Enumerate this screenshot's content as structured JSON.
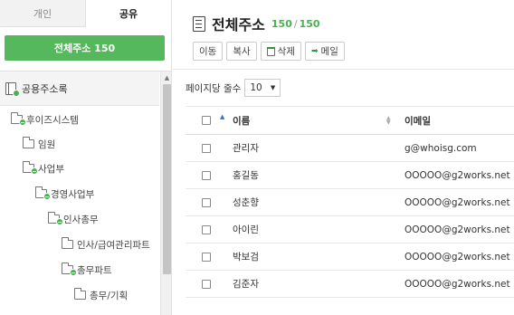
{
  "sidebar": {
    "tabs": [
      {
        "label": "개인",
        "active": false
      },
      {
        "label": "공유",
        "active": true
      }
    ],
    "all_button": "전체주소 150",
    "tree_root": "공용주소록",
    "tree": [
      {
        "label": "후이즈시스템",
        "badge": true
      },
      {
        "label": "임원",
        "badge": false
      },
      {
        "label": "사업부",
        "badge": true
      },
      {
        "label": "경영사업부",
        "badge": true
      },
      {
        "label": "인사총무",
        "badge": true
      },
      {
        "label": "인사/급여관리파트",
        "badge": false
      },
      {
        "label": "총무파트",
        "badge": true
      },
      {
        "label": "총무/기획",
        "badge": false
      }
    ]
  },
  "main": {
    "title": "전체주소",
    "count_current": "150",
    "count_separator": "/",
    "count_total": "150",
    "toolbar": {
      "move": "이동",
      "copy": "복사",
      "delete": "삭제",
      "mail": "메일"
    },
    "page_size_label": "페이지당 줄수",
    "page_size_value": "10",
    "columns": {
      "name": "이름",
      "email": "이메일"
    },
    "rows": [
      {
        "name": "관리자",
        "email": "g@whoisg.com"
      },
      {
        "name": "홍길동",
        "email": "OOOOO@g2works.net"
      },
      {
        "name": "성춘향",
        "email": "OOOOO@g2works.net"
      },
      {
        "name": "아이린",
        "email": "OOOOO@g2works.net"
      },
      {
        "name": "박보검",
        "email": "OOOOO@g2works.net"
      },
      {
        "name": "김준자",
        "email": "OOOOO@g2works.net"
      }
    ]
  },
  "colors": {
    "accent": "#56b85c",
    "count": "#4caf50",
    "sort_arrow": "#3b73c7"
  }
}
